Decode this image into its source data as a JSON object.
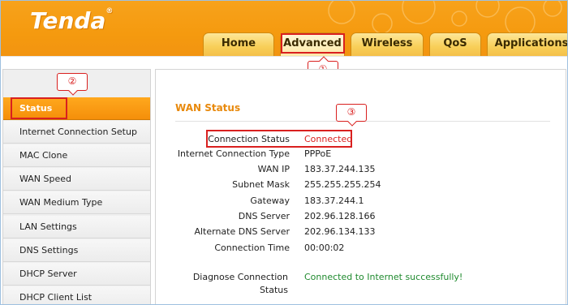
{
  "brand": {
    "logo_text": "Tenda",
    "registered": "®",
    "accent_color": "#f59a0f",
    "active_color": "#f58f0a"
  },
  "nav": {
    "tabs": [
      {
        "label": "Home"
      },
      {
        "label": "Advanced"
      },
      {
        "label": "Wireless"
      },
      {
        "label": "QoS"
      },
      {
        "label": "Applications"
      }
    ],
    "active": "Advanced"
  },
  "callouts": {
    "one": "①",
    "two": "②",
    "three": "③"
  },
  "sidebar": {
    "items": [
      {
        "label": "Status"
      },
      {
        "label": "Internet Connection Setup"
      },
      {
        "label": "MAC Clone"
      },
      {
        "label": "WAN Speed"
      },
      {
        "label": "WAN Medium Type"
      },
      {
        "label": "LAN Settings"
      },
      {
        "label": "DNS Settings"
      },
      {
        "label": "DHCP Server"
      },
      {
        "label": "DHCP Client List"
      }
    ],
    "active": "Status"
  },
  "wan_status": {
    "title": "WAN Status",
    "rows": [
      {
        "label": "Connection Status",
        "value": "Connected"
      },
      {
        "label": "Internet Connection Type",
        "value": "PPPoE"
      },
      {
        "label": "WAN IP",
        "value": "183.37.244.135"
      },
      {
        "label": "Subnet Mask",
        "value": "255.255.255.254"
      },
      {
        "label": "Gateway",
        "value": "183.37.244.1"
      },
      {
        "label": "DNS Server",
        "value": "202.96.128.166"
      },
      {
        "label": "Alternate DNS Server",
        "value": "202.96.134.133"
      },
      {
        "label": "Connection Time",
        "value": "00:00:02"
      }
    ],
    "diagnose": {
      "label_line1": "Diagnose Connection",
      "label_line2": "Status",
      "value": "Connected to Internet successfully!"
    }
  }
}
